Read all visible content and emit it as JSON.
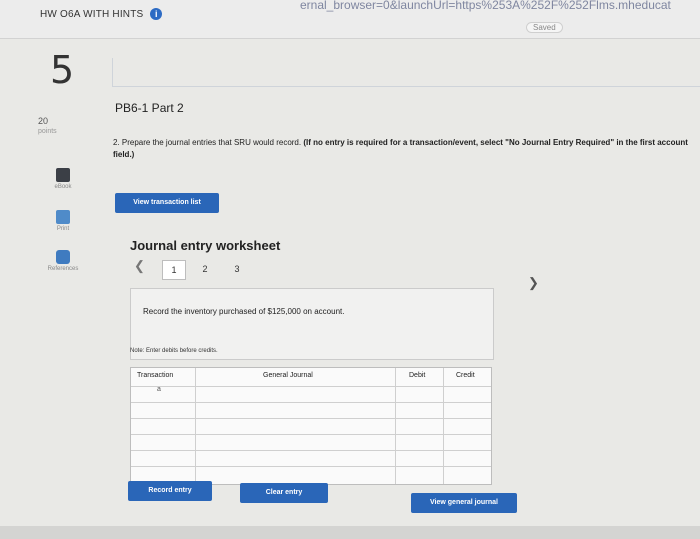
{
  "header": {
    "assignment_title": "HW O6A WITH HINTS",
    "info_icon": "info-icon",
    "url_text": "ernal_browser=0&launchUrl=https%253A%252F%252Flms.mheducat",
    "saved_label": "Saved"
  },
  "question": {
    "number": "5",
    "points_value": "20",
    "points_label": "points",
    "part_title": "PB6-1 Part 2",
    "instruction_main": "2. Prepare the journal entries that SRU would record.",
    "instruction_bold": "(If no entry is required for a transaction/event, select \"No Journal Entry Required\" in the first account field.)"
  },
  "sidebar": {
    "items": [
      {
        "label": "eBook",
        "icon": "ebook-icon"
      },
      {
        "label": "Print",
        "icon": "print-icon"
      },
      {
        "label": "References",
        "icon": "references-icon"
      }
    ]
  },
  "buttons": {
    "view_transaction_list": "View transaction list",
    "record_entry": "Record entry",
    "clear_entry": "Clear entry",
    "view_general_journal": "View general journal"
  },
  "worksheet": {
    "title": "Journal entry worksheet",
    "pages": [
      "1",
      "2",
      "3"
    ],
    "current_page": "1",
    "transaction_description": "Record the inventory purchased of $125,000 on account.",
    "note": "Note: Enter debits before credits.",
    "columns": [
      "Transaction",
      "General Journal",
      "Debit",
      "Credit"
    ],
    "rows": [
      {
        "transaction": "a"
      },
      {
        "transaction": ""
      },
      {
        "transaction": ""
      },
      {
        "transaction": ""
      },
      {
        "transaction": ""
      },
      {
        "transaction": ""
      }
    ]
  },
  "colors": {
    "primary_button": "#2a66b8",
    "background": "#e9e9e6"
  }
}
